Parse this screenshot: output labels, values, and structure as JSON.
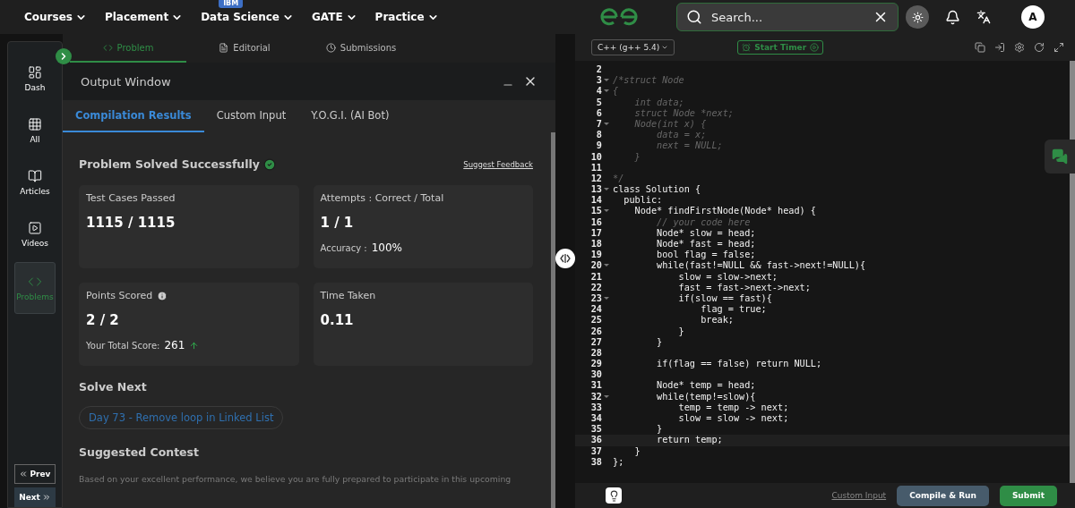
{
  "nav": {
    "items": [
      {
        "label": "Courses"
      },
      {
        "label": "Placement"
      },
      {
        "label": "Data Science",
        "badge": "IBM"
      },
      {
        "label": "GATE"
      },
      {
        "label": "Practice"
      }
    ],
    "search": {
      "placeholder": "Search..."
    },
    "avatar": "A"
  },
  "sidebar": {
    "items": [
      {
        "label": "Dash",
        "selected": false
      },
      {
        "label": "All",
        "selected": false
      },
      {
        "label": "Articles",
        "selected": false
      },
      {
        "label": "Videos",
        "selected": false
      },
      {
        "label": "Problems",
        "selected": true
      }
    ],
    "prev": "Prev",
    "next": "Next"
  },
  "problem_tabs": [
    {
      "label": "Problem",
      "selected": true
    },
    {
      "label": "Editorial",
      "selected": false
    },
    {
      "label": "Submissions",
      "selected": false
    }
  ],
  "output_window": {
    "title": "Output Window",
    "tabs": [
      {
        "label": "Compilation Results",
        "selected": true
      },
      {
        "label": "Custom Input",
        "selected": false
      },
      {
        "label": "Y.O.G.I. (AI Bot)",
        "selected": false
      }
    ],
    "status": "Problem Solved Successfully",
    "feedback": "Suggest Feedback",
    "cards": [
      {
        "title": "Test Cases Passed",
        "value": "1115 / 1115"
      },
      {
        "title": "Attempts : Correct / Total",
        "value": "1 / 1",
        "sub_label": "Accuracy :",
        "sub_value": "100%"
      },
      {
        "title": "Points Scored",
        "info": true,
        "value": "2 / 2",
        "sub_label": "Your Total Score:",
        "sub_value": "261",
        "rising": true
      },
      {
        "title": "Time Taken",
        "value": "0.11"
      }
    ],
    "solve_next": {
      "heading": "Solve Next",
      "link": "Day 73 - Remove loop in Linked List"
    },
    "contest": {
      "heading": "Suggested Contest",
      "text": "Based on your excellent performance, we believe you are fully prepared to participate in this upcoming"
    }
  },
  "editor": {
    "language": "C++ (g++ 5.4)",
    "timer": "Start Timer",
    "lines": [
      {
        "n": "2",
        "fold": false,
        "current": false
      },
      {
        "n": "3",
        "text": "/*struct Node",
        "kind": "comment",
        "fold": true,
        "current": false
      },
      {
        "n": "4",
        "text": "{",
        "kind": "comment",
        "fold": true,
        "current": false
      },
      {
        "n": "5",
        "text": "    int data;",
        "kind": "comment",
        "fold": false,
        "current": false
      },
      {
        "n": "6",
        "text": "    struct Node *next;",
        "kind": "comment",
        "fold": false,
        "current": false
      },
      {
        "n": "7",
        "text": "    Node(int x) {",
        "kind": "comment",
        "fold": true,
        "current": false
      },
      {
        "n": "8",
        "text": "        data = x;",
        "kind": "comment",
        "fold": false,
        "current": false
      },
      {
        "n": "9",
        "text": "        next = NULL;",
        "kind": "comment",
        "fold": false,
        "current": false
      },
      {
        "n": "10",
        "text": "    }",
        "kind": "comment",
        "fold": false,
        "current": false
      },
      {
        "n": "11",
        "fold": false,
        "current": false
      },
      {
        "n": "12",
        "text": "*/",
        "kind": "comment",
        "fold": false,
        "current": false
      },
      {
        "n": "13",
        "text": "class Solution {",
        "kind": "code",
        "fold": true,
        "current": false
      },
      {
        "n": "14",
        "text": "  public:",
        "kind": "code",
        "fold": false,
        "current": false
      },
      {
        "n": "15",
        "text": "    Node* findFirstNode(Node* head) {",
        "kind": "code",
        "fold": true,
        "current": false
      },
      {
        "n": "16",
        "text": "        // your code here",
        "kind": "comment",
        "fold": false,
        "current": false
      },
      {
        "n": "17",
        "text": "        Node* slow = head;",
        "kind": "code",
        "fold": false,
        "current": false
      },
      {
        "n": "18",
        "text": "        Node* fast = head;",
        "kind": "code",
        "fold": false,
        "current": false
      },
      {
        "n": "19",
        "text": "        bool flag = false;",
        "kind": "code",
        "fold": false,
        "current": false
      },
      {
        "n": "20",
        "text": "        while(fast!=NULL && fast->next!=NULL){",
        "kind": "code",
        "fold": true,
        "current": false
      },
      {
        "n": "21",
        "text": "            slow = slow->next;",
        "kind": "code",
        "fold": false,
        "current": false
      },
      {
        "n": "22",
        "text": "            fast = fast->next->next;",
        "kind": "code",
        "fold": false,
        "current": false
      },
      {
        "n": "23",
        "text": "            if(slow == fast){",
        "kind": "code",
        "fold": true,
        "current": false
      },
      {
        "n": "24",
        "text": "                flag = true;",
        "kind": "code",
        "fold": false,
        "current": false
      },
      {
        "n": "25",
        "text": "                break;",
        "kind": "code",
        "fold": false,
        "current": false
      },
      {
        "n": "26",
        "text": "            }",
        "kind": "code",
        "fold": false,
        "current": false
      },
      {
        "n": "27",
        "text": "        }",
        "kind": "code",
        "fold": false,
        "current": false
      },
      {
        "n": "28",
        "fold": false,
        "current": false
      },
      {
        "n": "29",
        "text": "        if(flag == false) return NULL;",
        "kind": "code",
        "fold": false,
        "current": false
      },
      {
        "n": "30",
        "fold": false,
        "current": false
      },
      {
        "n": "31",
        "text": "        Node* temp = head;",
        "kind": "code",
        "fold": false,
        "current": false
      },
      {
        "n": "32",
        "text": "        while(temp!=slow){",
        "kind": "code",
        "fold": true,
        "current": false
      },
      {
        "n": "33",
        "text": "            temp = temp -> next;",
        "kind": "code",
        "fold": false,
        "current": false
      },
      {
        "n": "34",
        "text": "            slow = slow -> next;",
        "kind": "code",
        "fold": false,
        "current": false
      },
      {
        "n": "35",
        "text": "        }",
        "kind": "code",
        "fold": false,
        "current": false
      },
      {
        "n": "36",
        "text": "        return temp;",
        "kind": "code",
        "fold": false,
        "current": true
      },
      {
        "n": "37",
        "text": "    }",
        "kind": "code",
        "fold": false,
        "current": false
      },
      {
        "n": "38",
        "text": "};",
        "kind": "code",
        "fold": false,
        "current": false
      }
    ],
    "custom_input": "Custom Input",
    "compile": "Compile & Run",
    "submit": "Submit"
  }
}
